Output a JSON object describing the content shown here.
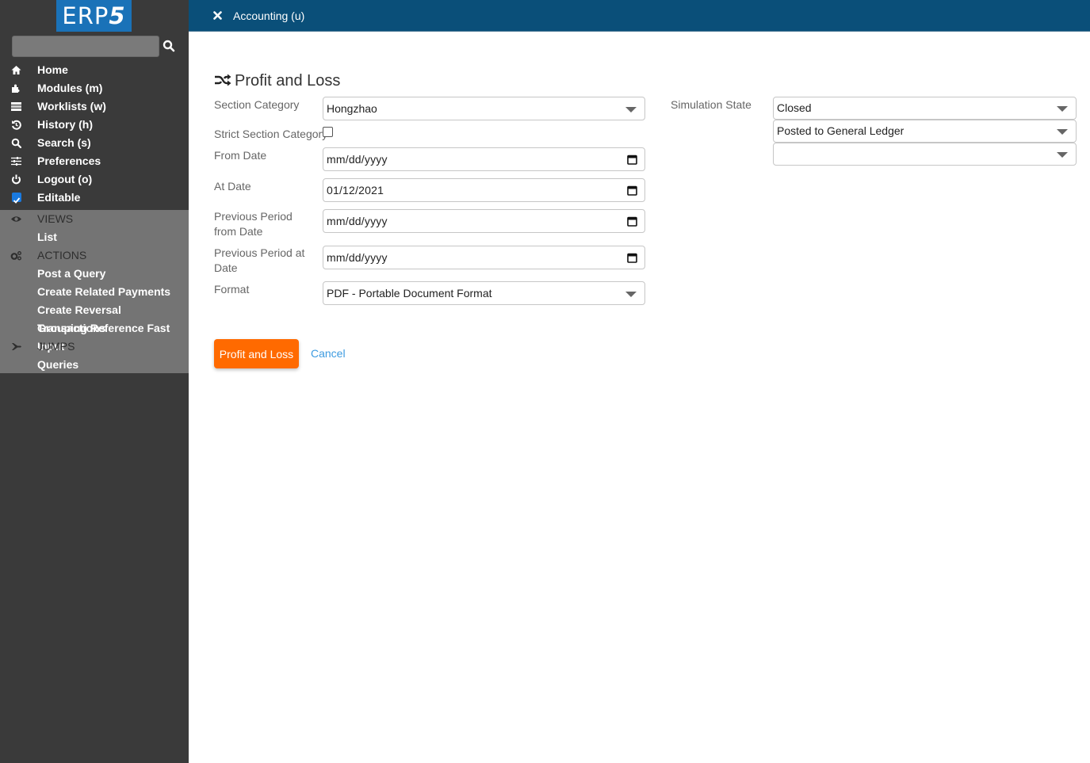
{
  "sidebar": {
    "logo": {
      "text": "ERP",
      "suffix": "5"
    },
    "search": {
      "value": "",
      "placeholder": ""
    },
    "nav_items": [
      {
        "label": "Home",
        "icon": "home-icon"
      },
      {
        "label": "Modules (m)",
        "icon": "puzzle-icon"
      },
      {
        "label": "Worklists (w)",
        "icon": "tasks-icon"
      },
      {
        "label": "History (h)",
        "icon": "history-icon"
      },
      {
        "label": "Search (s)",
        "icon": "search-icon"
      },
      {
        "label": "Preferences",
        "icon": "sliders-icon"
      },
      {
        "label": "Logout (o)",
        "icon": "power-icon"
      },
      {
        "label": "Editable",
        "icon": "checkbox-checked-icon",
        "checked": true
      }
    ],
    "sections": {
      "views": {
        "title": "VIEWS",
        "items": [
          "List"
        ]
      },
      "actions": {
        "title": "ACTIONS",
        "items": [
          "Post a Query",
          "Create Related Payments",
          "Create Reversal Transactions",
          "Grouping Reference Fast Input"
        ]
      },
      "jumps": {
        "title": "JUMPS",
        "items": [
          "Queries"
        ]
      }
    }
  },
  "header": {
    "title": "Accounting (u)"
  },
  "form": {
    "title": "Profit and Loss",
    "section_category": {
      "label": "Section Category",
      "value": "Hongzhao"
    },
    "strict_section_category": {
      "label": "Strict Section Category",
      "checked": false
    },
    "from_date": {
      "label": "From Date",
      "value": "mm/dd/yyyy"
    },
    "at_date": {
      "label": "At Date",
      "value": "01/12/2021"
    },
    "previous_period_from_date": {
      "label": "Previous Period from Date",
      "value": "mm/dd/yyyy"
    },
    "previous_period_at_date": {
      "label": "Previous Period at Date",
      "value": "mm/dd/yyyy"
    },
    "format": {
      "label": "Format",
      "value": "PDF - Portable Document Format"
    },
    "simulation_state": {
      "label": "Simulation State",
      "values": [
        "Closed",
        "Posted to General Ledger",
        ""
      ]
    },
    "submit_label": "Profit and Loss",
    "cancel_label": "Cancel"
  },
  "colors": {
    "sidebar_bg": "#3a3a3a",
    "sidebar_sub_bg": "#747474",
    "header_bg": "#0a4f79",
    "logo_bg": "#1a72b8",
    "primary_button": "#ff6a00",
    "link": "#3d9be0"
  }
}
